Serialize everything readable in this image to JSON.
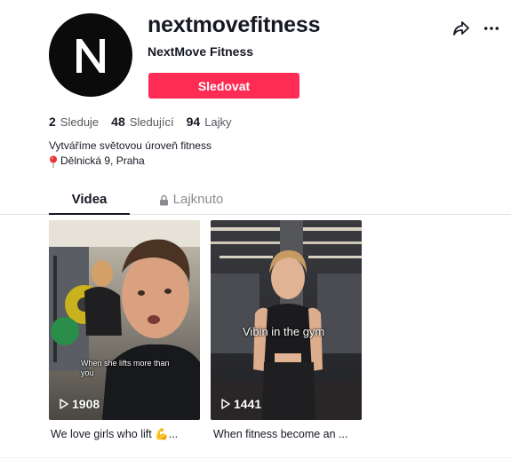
{
  "profile": {
    "username": "nextmovefitness",
    "display_name": "NextMove Fitness",
    "avatar_letter": "N",
    "follow_label": "Sledovat"
  },
  "actions": {
    "share_icon": "share-arrow-icon",
    "more_icon": "more-horizontal-icon"
  },
  "stats": [
    {
      "value": "2",
      "label": "Sleduje"
    },
    {
      "value": "48",
      "label": "Sledující"
    },
    {
      "value": "94",
      "label": "Lajky"
    }
  ],
  "bio": {
    "line1": "Vytváříme světovou úroveň fitness",
    "location_icon": "pin-icon",
    "location": "Dělnická 9, Praha"
  },
  "tabs": [
    {
      "label": "Videa",
      "active": true
    },
    {
      "label": "Lajknuto",
      "active": false,
      "icon": "lock-icon"
    }
  ],
  "videos": [
    {
      "overlay_text": "When she lifts more than you",
      "plays": "1908",
      "caption": "We love girls who lift 💪..."
    },
    {
      "overlay_text": "Vibin in the gym",
      "plays": "1441",
      "caption": "When fitness become an ..."
    }
  ],
  "colors": {
    "accent": "#fe2c55",
    "text": "#161823",
    "muted": "#8a8b91"
  }
}
